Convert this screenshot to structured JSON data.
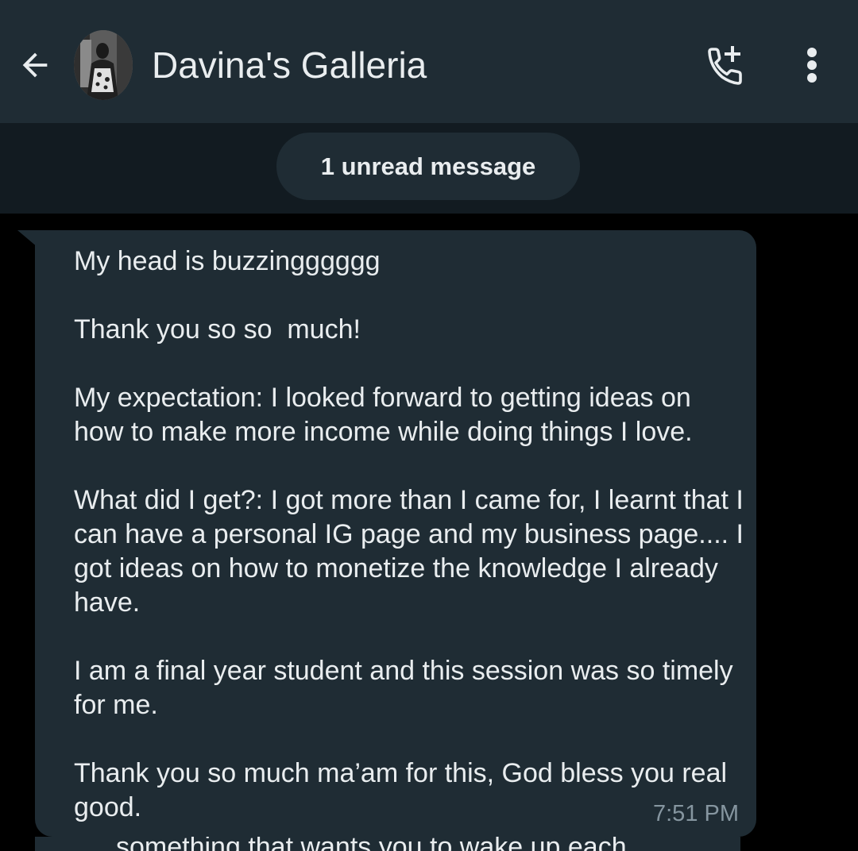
{
  "header": {
    "title": "Davina's Galleria",
    "back_icon": "arrow-left-icon",
    "call_icon": "add-call-icon",
    "menu_icon": "more-vert-icon",
    "avatar_icon": "profile-photo"
  },
  "unread_banner": {
    "label": "1 unread message"
  },
  "message": {
    "text": "My head is buzzingggggg\n\nThank you so so  much!\n\nMy expectation: I looked forward to getting ideas on how to make more income while doing things I love.\n\nWhat did I get?: I got more than I came for, I learnt that I can have a personal IG page and my business page.... I got ideas on how to monetize the knowledge I already have.\n\nI am a final year student and this session was so timely for me.\n\nThank you so much ma’am for this, God bless you real good.",
    "time": "7:51 PM"
  },
  "next_message": {
    "partial_text": "something that wants you to wake up each"
  },
  "colors": {
    "header_bg": "#1f2c34",
    "bubble_bg": "#1f2c34",
    "chat_bg": "#000000",
    "text": "#e9edef",
    "muted_text": "#8696a0"
  }
}
